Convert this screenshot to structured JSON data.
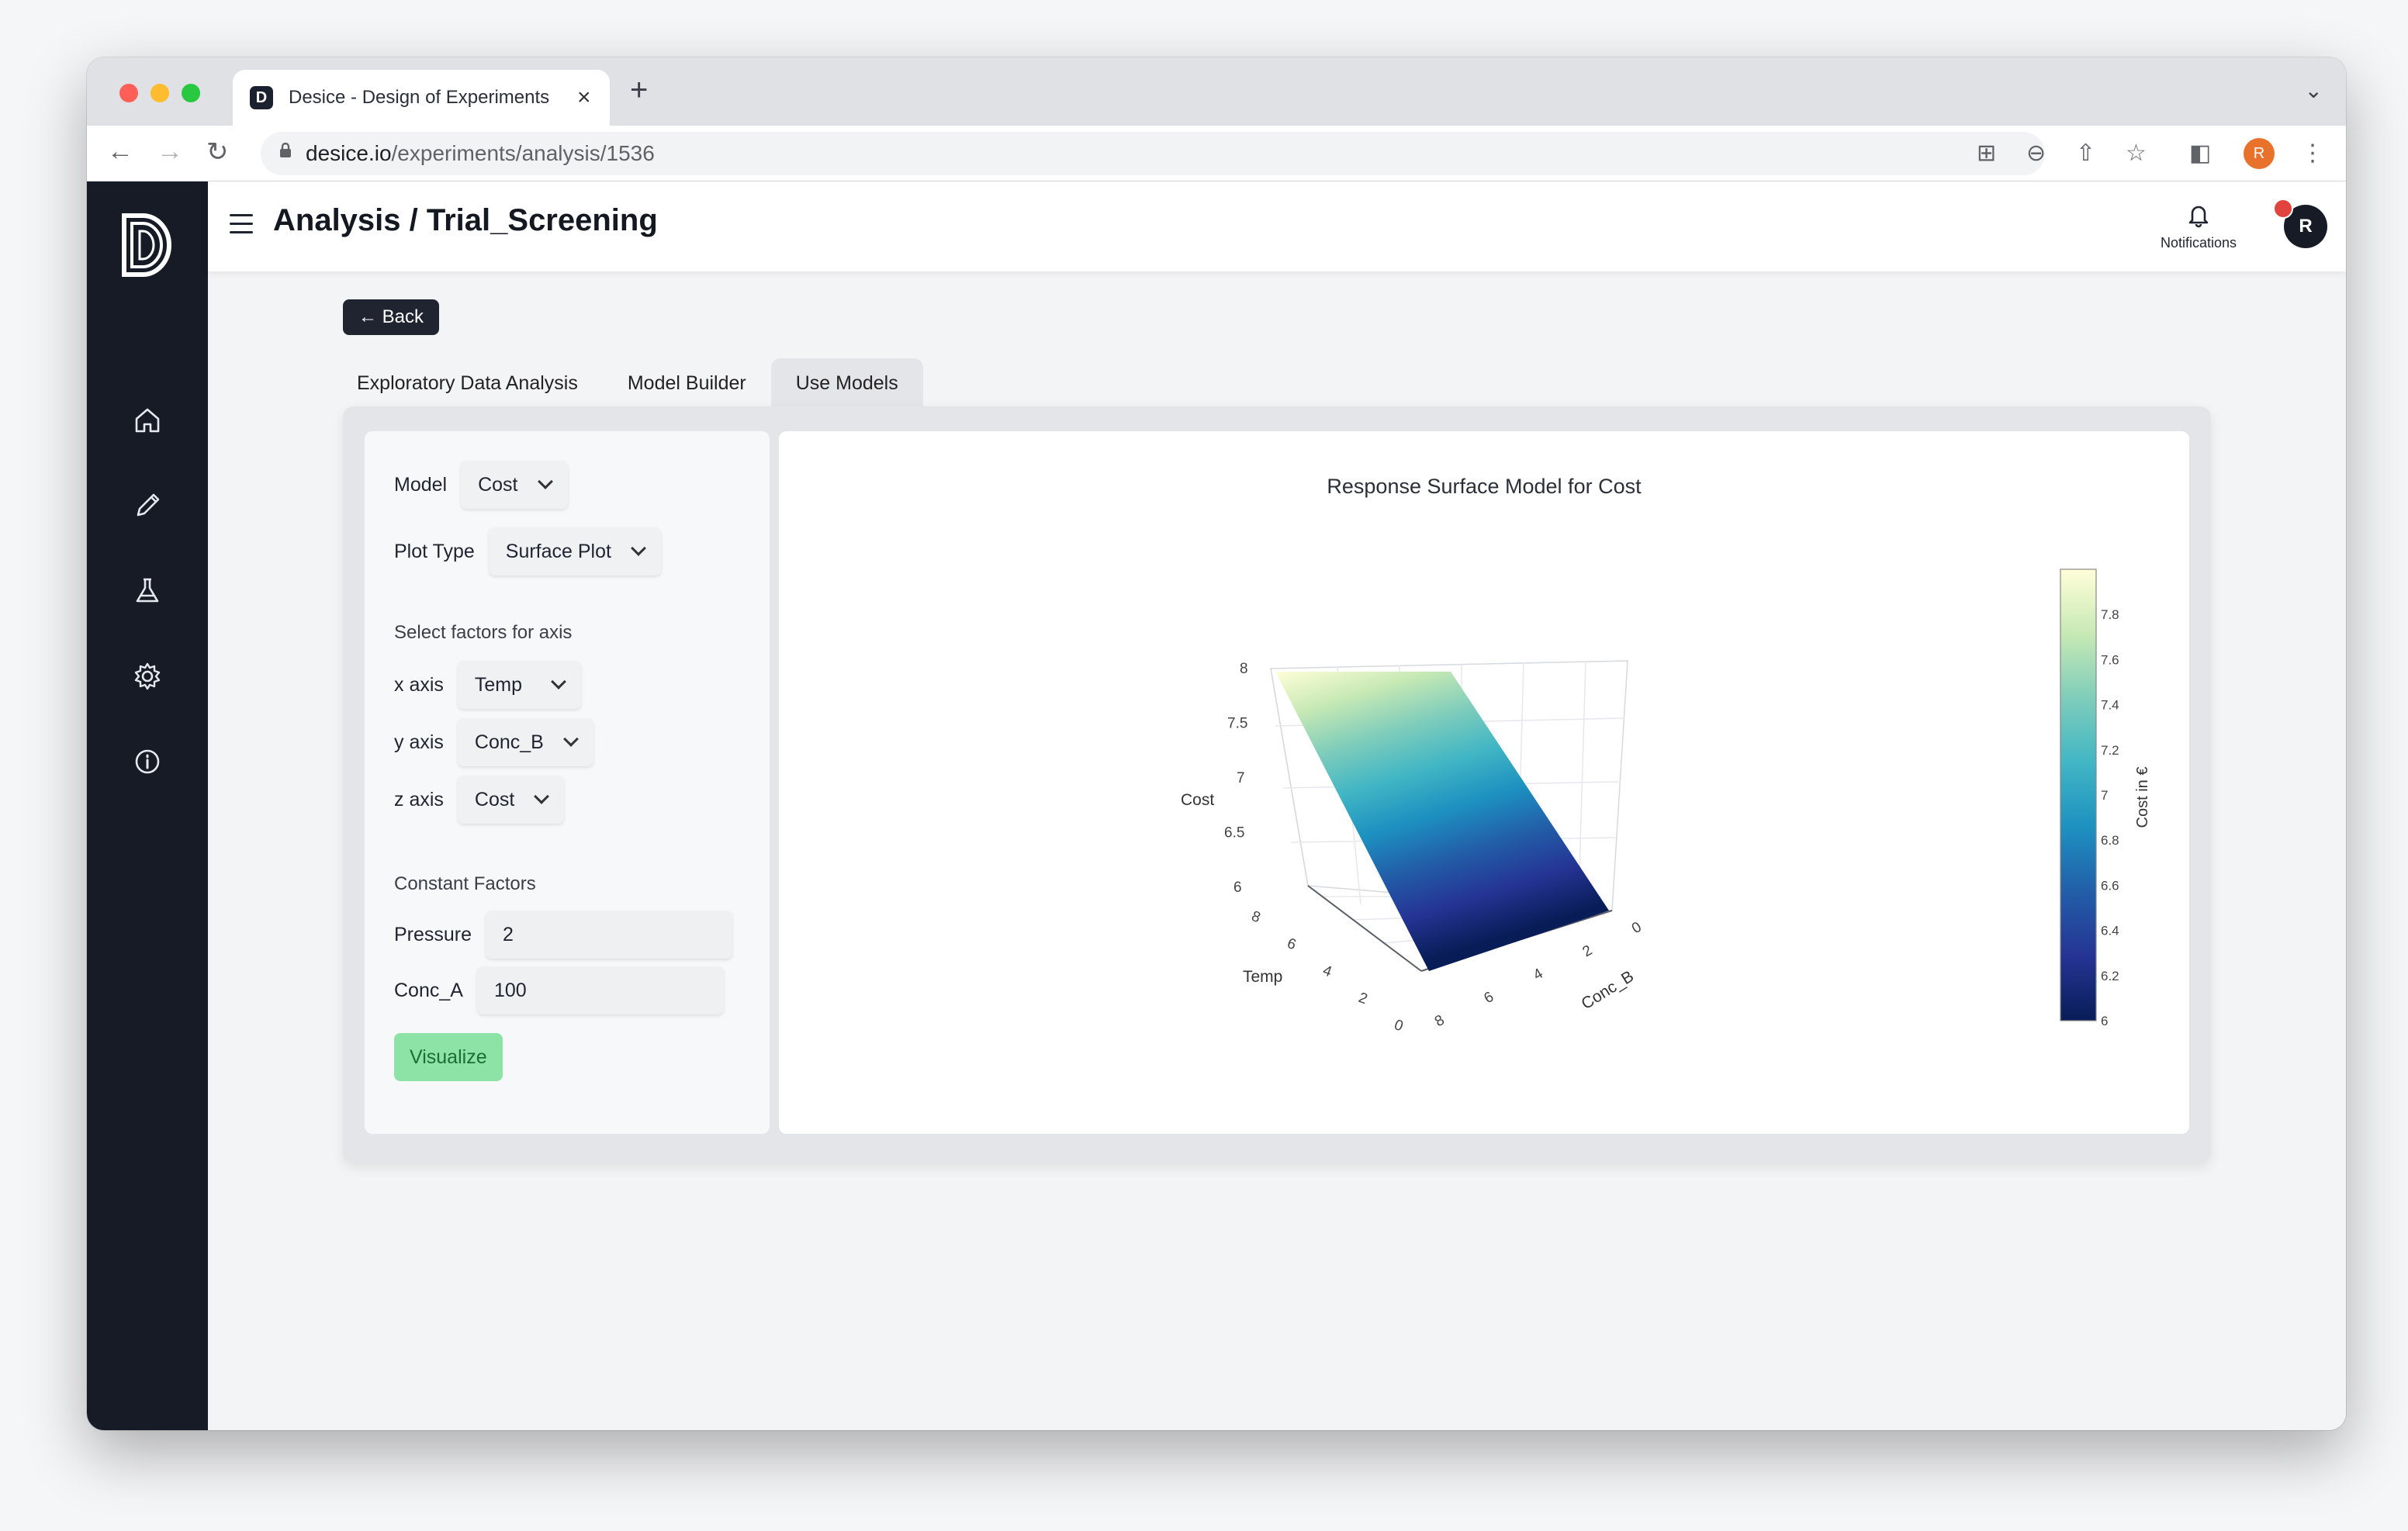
{
  "browser": {
    "tab_title": "Desice - Design of Experiments",
    "favicon_letter": "D",
    "url_host": "desice.io",
    "url_path": "/experiments/analysis/1536",
    "profile_letter": "R"
  },
  "header": {
    "title": "Analysis / Trial_Screening",
    "notifications_label": "Notifications",
    "avatar_letter": "R"
  },
  "back_label": "← Back",
  "tabs": [
    {
      "label": "Exploratory Data Analysis",
      "active": false
    },
    {
      "label": "Model Builder",
      "active": false
    },
    {
      "label": "Use Models",
      "active": true
    }
  ],
  "controls": {
    "model_label": "Model",
    "model_value": "Cost",
    "plot_type_label": "Plot Type",
    "plot_type_value": "Surface Plot",
    "axis_section": "Select factors for axis",
    "x_label": "x axis",
    "x_value": "Temp",
    "y_label": "y axis",
    "y_value": "Conc_B",
    "z_label": "z axis",
    "z_value": "Cost",
    "constant_section": "Constant Factors",
    "pressure_label": "Pressure",
    "pressure_value": "2",
    "conc_a_label": "Conc_A",
    "conc_a_value": "100",
    "visualize_label": "Visualize"
  },
  "chart_data": {
    "type": "surface",
    "title": "Response Surface Model for Cost",
    "x_label": "Temp",
    "y_label": "Conc_B",
    "z_label": "Cost",
    "x_ticks": [
      "0",
      "2",
      "4",
      "6",
      "8"
    ],
    "y_ticks": [
      "0",
      "2",
      "4",
      "6",
      "8"
    ],
    "z_ticks": [
      "6",
      "6.5",
      "7",
      "7.5",
      "8"
    ],
    "z_range": [
      6,
      8
    ],
    "colorbar_title": "Cost in €",
    "colorbar_ticks": [
      "6",
      "6.2",
      "6.4",
      "6.6",
      "6.8",
      "7",
      "7.2",
      "7.4",
      "7.6",
      "7.8"
    ],
    "colorscale": [
      "#fffed8",
      "#c7e9b4",
      "#7fcdbb",
      "#41b6c4",
      "#1d91c0",
      "#225ea8",
      "#253494",
      "#081d58"
    ]
  }
}
